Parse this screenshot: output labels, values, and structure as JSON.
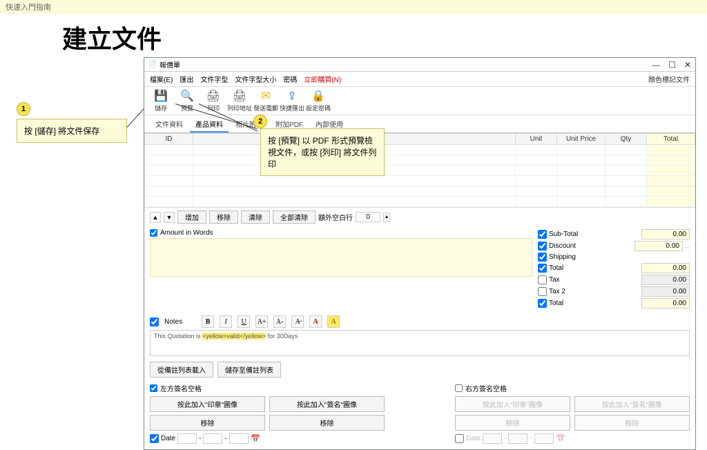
{
  "banner": "快速入門指南",
  "page_title": "建立文件",
  "window": {
    "title": "報價單",
    "controls": {
      "min": "—",
      "max": "☐",
      "close": "✕"
    }
  },
  "menu": {
    "items": [
      "檔案(E)",
      "匯出",
      "文件字型",
      "文件字型大小",
      "密碼"
    ],
    "buy_now": "立即購買(N)",
    "right": "顔色標記文件"
  },
  "toolbar": [
    {
      "name": "save-icon",
      "label": "儲存",
      "color": "#1e6fbf"
    },
    {
      "name": "preview-icon",
      "label": "預覽",
      "color": "#1e6fbf"
    },
    {
      "name": "print-icon",
      "label": "列印",
      "color": "#555"
    },
    {
      "name": "print-address-icon",
      "label": "列印地址",
      "color": "#555"
    },
    {
      "name": "email-icon",
      "label": "發送電郵",
      "color": "#f4b400"
    },
    {
      "name": "export-icon",
      "label": "快捷匯出",
      "color": "#1e6fbf"
    },
    {
      "name": "password-icon",
      "label": "設定密碼",
      "color": "#f4b400"
    }
  ],
  "tabs": [
    "文件資料",
    "產品資料",
    "相片附頁",
    "附加PDF",
    "內部使用"
  ],
  "grid_headers": [
    "ID",
    "",
    "Unit",
    "Unit Price",
    "Qty",
    "Total"
  ],
  "row_ctrl": {
    "add": "增加",
    "remove": "移除",
    "clear": "清除",
    "clear_all": "全部清除",
    "extra_rows": "額外空白行",
    "extra_val": "0"
  },
  "amount_words": "Amount in Words",
  "totals": [
    {
      "label": "Sub-Total",
      "value": "0.00",
      "checked": true,
      "yellow": true
    },
    {
      "label": "Discount",
      "value": "0.00",
      "checked": true,
      "yellow": true,
      "dots": true
    },
    {
      "label": "Shipping",
      "value": "",
      "checked": true,
      "yellow": false,
      "border": false
    },
    {
      "label": "Total",
      "value": "0.00",
      "checked": true,
      "yellow": true
    },
    {
      "label": "Tax",
      "value": "0.00",
      "checked": false,
      "gray": true
    },
    {
      "label": "Tax 2",
      "value": "0.00",
      "checked": false,
      "gray": true
    },
    {
      "label": "Total",
      "value": "0.00",
      "checked": true,
      "yellow": true
    }
  ],
  "notes": {
    "label": "Notes",
    "text_a": "This Quotation is ",
    "text_b": "<yellow>valid</yellow>",
    "text_c": " for 30Days",
    "fmt": [
      "B",
      "I",
      "U",
      "A+",
      "A-",
      "A̶",
      "A",
      "A"
    ]
  },
  "note_btns": {
    "load": "從備註列表載入",
    "save": "儲存至備註列表"
  },
  "sig": {
    "left_title": "左方簽名空格",
    "right_title": "右方簽名空格",
    "stamp": "按此加入\"印章\"圖像",
    "sign": "按此加入\"簽名\"圖像",
    "remove": "移除",
    "date": "Date"
  },
  "callouts": {
    "c1": "按 [儲存] 將文件保存",
    "c2": "按 [預覽] 以 PDF 形式預覽檢視文件，或按 [列印] 將文件列印"
  }
}
